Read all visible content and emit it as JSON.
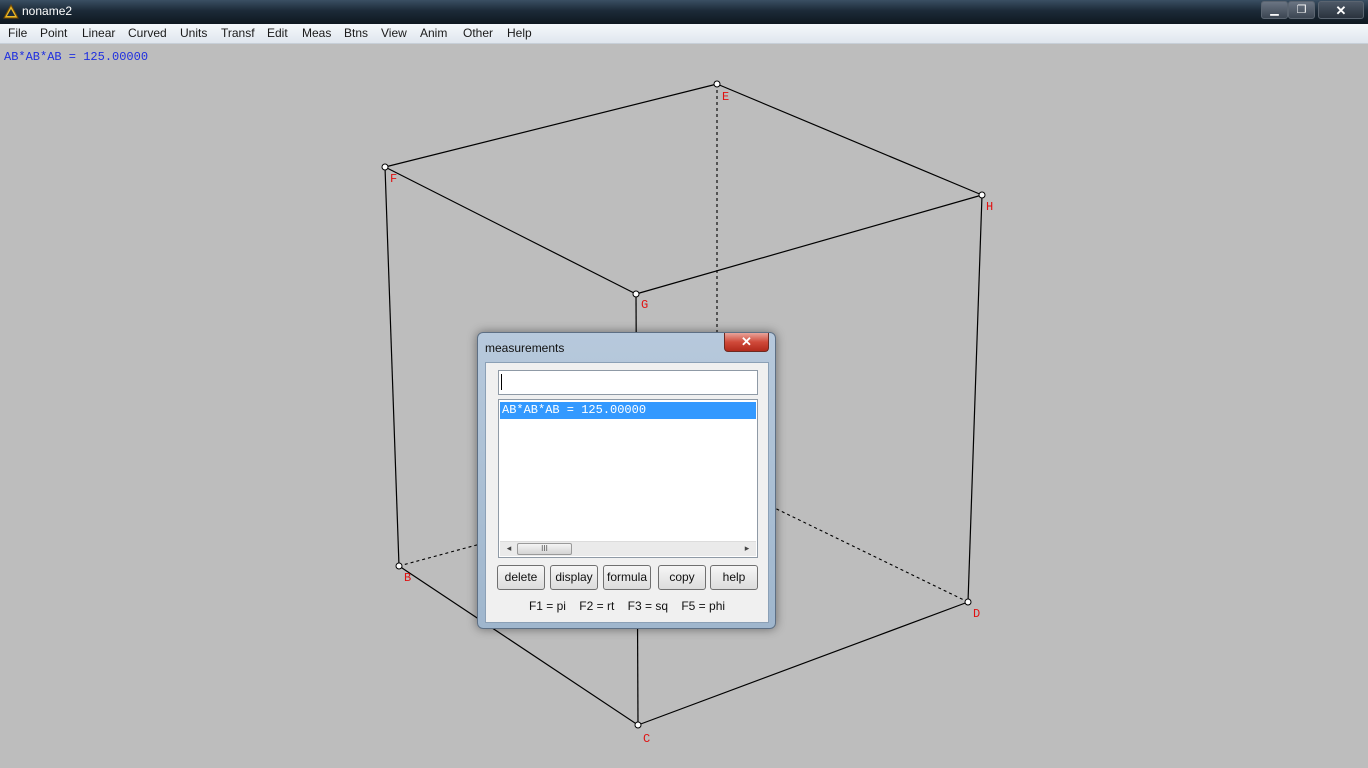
{
  "window": {
    "title": "noname2",
    "minimize": "▁",
    "maximize": "❐",
    "close": "✕"
  },
  "menu": [
    "File",
    "Point",
    "Linear",
    "Curved",
    "Units",
    "Transf",
    "Edit",
    "Meas",
    "Btns",
    "View",
    "Anim",
    "Other",
    "Help"
  ],
  "canvas": {
    "readout": "AB*AB*AB = 125.00000",
    "vertex_labels": [
      "E",
      "F",
      "H",
      "G",
      "B",
      "D",
      "C"
    ],
    "line_color": "#000000",
    "label_color": "#e01010",
    "readout_color": "#1f2fe0"
  },
  "dialog": {
    "title": "measurements",
    "close": "✕",
    "input_value": "",
    "list_items": [
      "AB*AB*AB = 125.00000"
    ],
    "buttons": [
      "delete",
      "display",
      "formula",
      "copy",
      "help"
    ],
    "hint": "F1 = pi    F2 = rt    F3 = sq    F5 = phi",
    "selection_color": "#3399ff",
    "scroll": {
      "left": "◂",
      "right": "▸",
      "thumb": "III"
    }
  }
}
